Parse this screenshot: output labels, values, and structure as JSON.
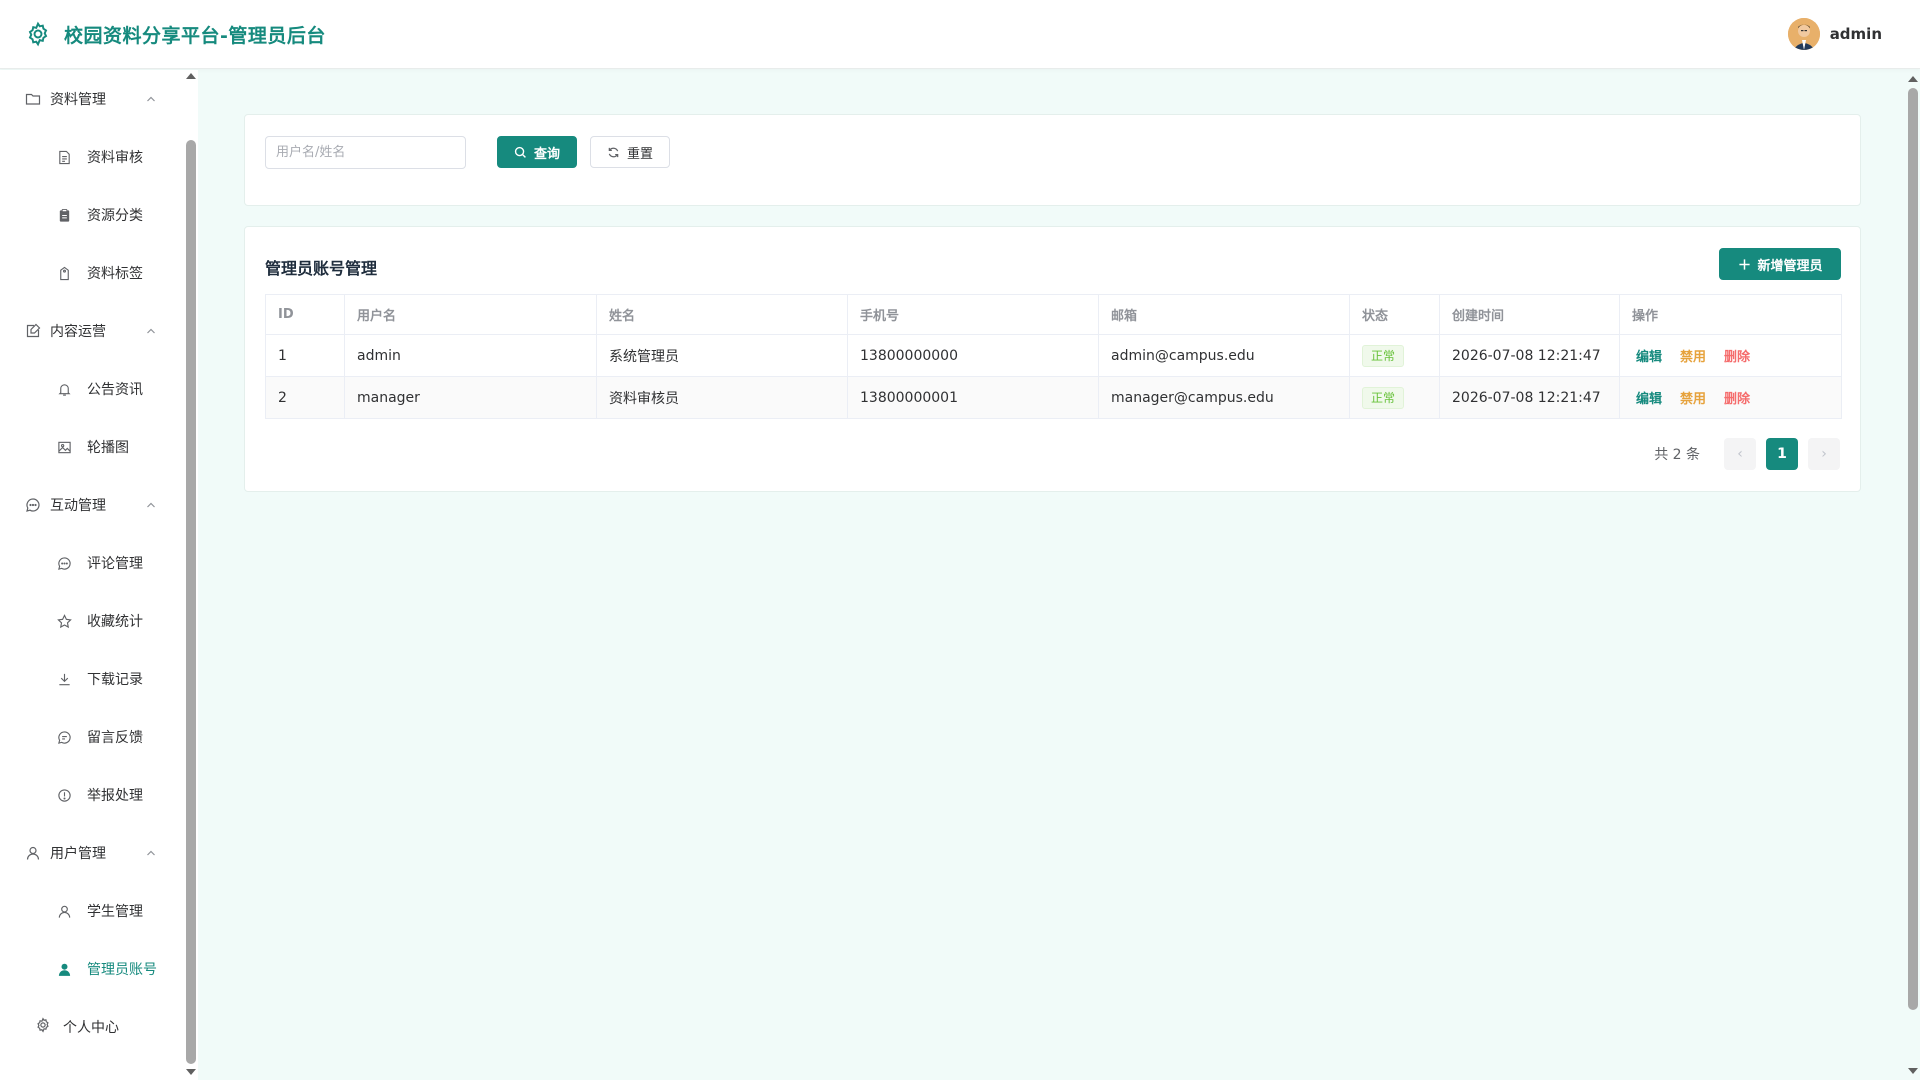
{
  "app": {
    "title": "校园资料分享平台-管理员后台",
    "user": "admin",
    "accent_color": "#168a7e"
  },
  "sidebar": {
    "groups": [
      {
        "label": "资料管理",
        "icon": "folder-icon",
        "items": [
          {
            "label": "资料审核",
            "icon": "document-icon"
          },
          {
            "label": "资源分类",
            "icon": "clipboard-icon"
          },
          {
            "label": "资料标签",
            "icon": "tag-icon"
          }
        ]
      },
      {
        "label": "内容运营",
        "icon": "content-icon",
        "items": [
          {
            "label": "公告资讯",
            "icon": "bell-icon"
          },
          {
            "label": "轮播图",
            "icon": "image-icon"
          }
        ]
      },
      {
        "label": "互动管理",
        "icon": "chat-icon",
        "items": [
          {
            "label": "评论管理",
            "icon": "comment-icon"
          },
          {
            "label": "收藏统计",
            "icon": "star-icon"
          },
          {
            "label": "下载记录",
            "icon": "download-icon"
          },
          {
            "label": "留言反馈",
            "icon": "message-icon"
          },
          {
            "label": "举报处理",
            "icon": "warning-icon"
          }
        ]
      },
      {
        "label": "用户管理",
        "icon": "user-icon",
        "items": [
          {
            "label": "学生管理",
            "icon": "user-icon"
          },
          {
            "label": "管理员账号",
            "icon": "user-filled-icon",
            "active": true
          }
        ]
      }
    ],
    "footer_item": {
      "label": "个人中心",
      "icon": "gear-icon"
    }
  },
  "search": {
    "placeholder": "用户名/姓名",
    "value": "",
    "query_label": "查询",
    "reset_label": "重置"
  },
  "table_card": {
    "title": "管理员账号管理",
    "add_label": "新增管理员",
    "columns": [
      "ID",
      "用户名",
      "姓名",
      "手机号",
      "邮箱",
      "状态",
      "创建时间",
      "操作"
    ],
    "rows": [
      {
        "id": "1",
        "username": "admin",
        "name": "系统管理员",
        "phone": "13800000000",
        "email": "admin@campus.edu",
        "status": "正常",
        "created": "2026-07-08 12:21:47"
      },
      {
        "id": "2",
        "username": "manager",
        "name": "资料审核员",
        "phone": "13800000001",
        "email": "manager@campus.edu",
        "status": "正常",
        "created": "2026-07-08 12:21:47"
      }
    ],
    "actions": {
      "edit": "编辑",
      "disable": "禁用",
      "delete": "删除"
    },
    "status_color": "#67c23a"
  },
  "pagination": {
    "total_text": "共 2 条",
    "current_page": "1",
    "prev": "‹",
    "next": "›"
  }
}
